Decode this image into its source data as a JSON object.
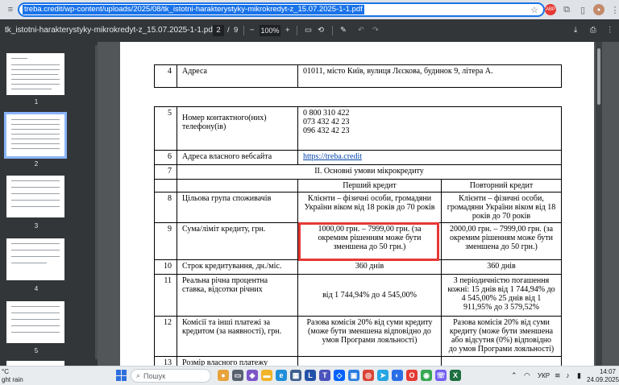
{
  "browser": {
    "url": "treba.credit/wp-content/uploads/2025/08/tk_istotni-harakterystyky-mikrokredyt-z_15.07.2025-1-1.pdf"
  },
  "pdf_toolbar": {
    "filename": "tk_istotni-harakterystyky-mikrokredyt-z_15.07.2025-1-1.pdf",
    "current_page": "2",
    "page_sep": "/",
    "total_pages": "9",
    "zoom": "100%"
  },
  "thumbnails": [
    {
      "num": "1"
    },
    {
      "num": "2"
    },
    {
      "num": "3"
    },
    {
      "num": "4"
    },
    {
      "num": "5"
    }
  ],
  "page_top_row": {
    "num": "4",
    "label": "Адреса",
    "value": "01011, місто Київ, вулиця Лєскова, будинок 9, літера А."
  },
  "table": {
    "row5": {
      "num": "5",
      "label": "Номер контактного(них) телефону(ів)",
      "phones": [
        "0 800 310 422",
        "073 432 42 23",
        "096 432 42 23"
      ]
    },
    "row6": {
      "num": "6",
      "label": "Адреса власного вебсайта",
      "value": "https://treba.credit"
    },
    "row7": {
      "num": "7",
      "value": "II. Основні умови мікрокредиту"
    },
    "header": {
      "first": "Перший кредит",
      "repeat": "Повторний кредит"
    },
    "row8": {
      "num": "8",
      "label": "Цільова група споживачів",
      "first": "Клієнти – фізичні особи, громадяни України віком від 18 років до 70 років",
      "repeat": "Клієнти – фізичні особи, громадяни України віком від 18 років до 70 років"
    },
    "row9": {
      "num": "9",
      "label": "Сума/ліміт кредиту, грн.",
      "first": "1000,00 грн. – 7999,00 грн. (за окремим рішенням може бути зменшена до 50 грн.)",
      "repeat": "2000,00 грн. – 7999,00 грн. (за окремим рішенням може бути зменшена до 50 грн.)"
    },
    "row10": {
      "num": "10",
      "label": "Строк кредитування, дн./міс.",
      "first": "360 днів",
      "repeat": "360 днів"
    },
    "row11": {
      "num": "11",
      "label": "Реальна річна процентна ставка, відсотки річних",
      "first": "від 1 744,94% до 4 545,00%",
      "repeat": "З періодичністю погашення кожні: 15 днів від 1 744,94% до 4 545,00% 25 днів від 1 911,95% до 3 579,52%"
    },
    "row12": {
      "num": "12",
      "label": "Комісії та інші платежі за кредитом (за наявності), грн.",
      "first": "Разова комісія 20% від суми кредиту (може бути зменшена відповідно до умов Програми лояльності)",
      "repeat": "Разова комісія 20% від суми кредиту (може бути зменшена або відсутня (0%) відповідно до умов Програми лояльності)"
    },
    "row13": {
      "num": "13",
      "label": "Розмір власного платежу"
    }
  },
  "taskbar": {
    "weather_temp": "°C",
    "weather_desc": "ght rain",
    "search_placeholder": "Пошук",
    "lang": "УКР",
    "time": "14:07",
    "date": "24.09.2025"
  }
}
